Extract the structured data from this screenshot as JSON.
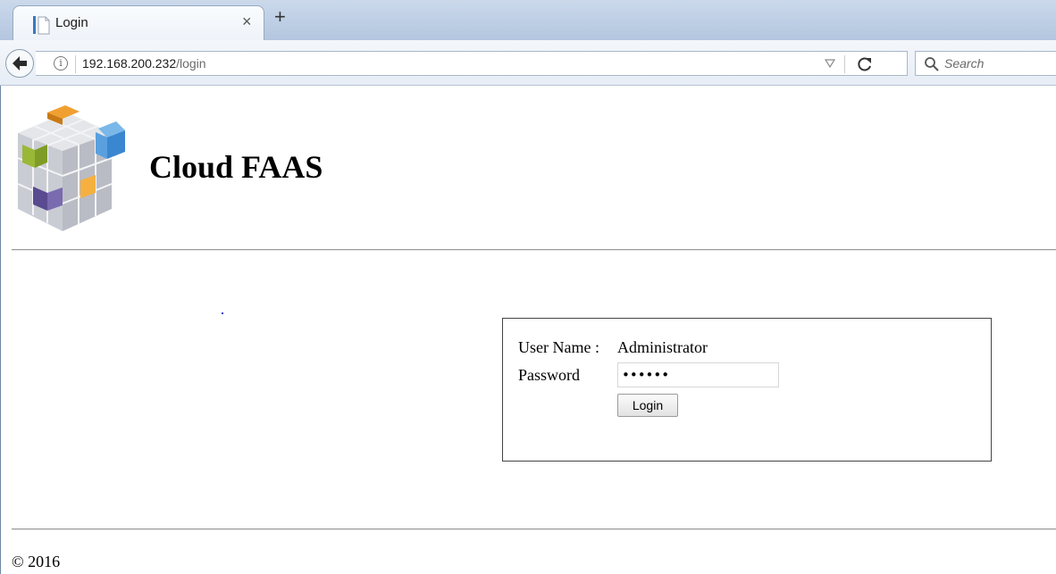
{
  "browser": {
    "tab": {
      "title": "Login",
      "close_glyph": "×",
      "new_tab_glyph": "+"
    },
    "url": {
      "host": "192.168.200.232",
      "path": "/login"
    },
    "search": {
      "placeholder": "Search"
    },
    "icons": [
      "back-arrow-icon",
      "info-icon",
      "dropdown-icon",
      "reload-icon",
      "search-icon"
    ]
  },
  "header": {
    "title": "Cloud FAAS",
    "logo": "cube-logo-icon"
  },
  "login": {
    "user_label": "User Name :",
    "user_value": "Administrator",
    "password_label": "Password",
    "password_value": "••••••",
    "button_label": "Login"
  },
  "footer": {
    "text": "© 2016"
  },
  "colors": {
    "chrome_blue": "#b3c6df",
    "accent_blue": "#3a78c2"
  }
}
